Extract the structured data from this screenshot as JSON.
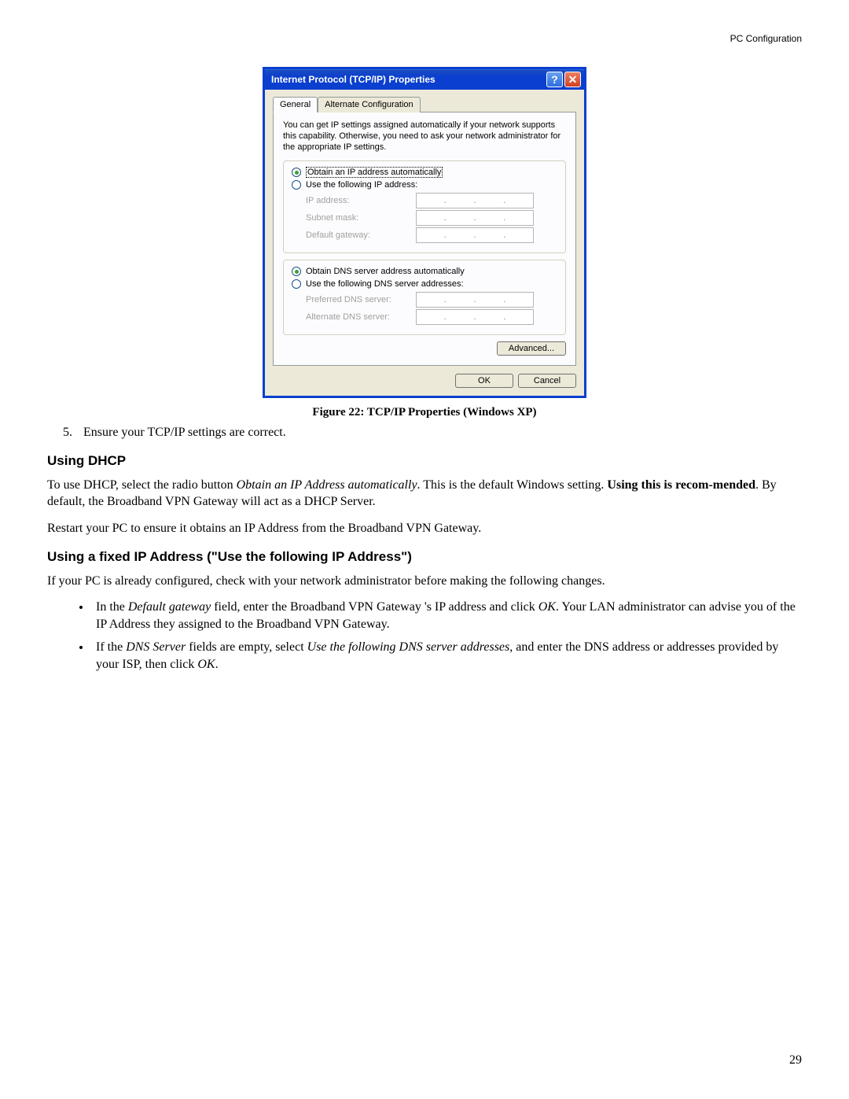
{
  "page": {
    "header": "PC Configuration",
    "number": "29"
  },
  "dialog": {
    "title": "Internet Protocol (TCP/IP) Properties",
    "helpGlyph": "?",
    "closeGlyph": "✕",
    "tabs": {
      "general": "General",
      "alt": "Alternate Configuration"
    },
    "description": "You can get IP settings assigned automatically if your network supports this capability. Otherwise, you need to ask your network administrator for the appropriate IP settings.",
    "ip": {
      "auto": "Obtain an IP address automatically",
      "manual": "Use the following IP address:",
      "fields": {
        "address": "IP address:",
        "subnet": "Subnet mask:",
        "gateway": "Default gateway:"
      }
    },
    "dns": {
      "auto": "Obtain DNS server address automatically",
      "manual": "Use the following DNS server addresses:",
      "fields": {
        "preferred": "Preferred DNS server:",
        "alternate": "Alternate DNS server:"
      }
    },
    "advanced": "Advanced...",
    "ok": "OK",
    "cancel": "Cancel"
  },
  "doc": {
    "caption": "Figure 22: TCP/IP Properties (Windows XP)",
    "step5_num": "5.",
    "step5_text": "Ensure your TCP/IP settings are correct.",
    "h_dhcp": "Using DHCP",
    "dhcp_p1_a": "To use DHCP, select the radio button ",
    "dhcp_p1_em": "Obtain an IP Address automatically",
    "dhcp_p1_b": ". This is the default Windows setting. ",
    "dhcp_p1_strong": "Using this is recom-mended",
    "dhcp_p1_c": ". By default, the Broadband VPN Gateway will act as a DHCP Server.",
    "dhcp_p2": "Restart your PC to ensure it obtains an IP Address from the Broadband VPN Gateway.",
    "h_fixed": "Using a fixed IP Address (\"Use the following IP Address\")",
    "fixed_p1": "If your PC is already configured, check with your network administrator before making the following changes.",
    "b1_a": "In the ",
    "b1_em1": "Default gateway",
    "b1_b": " field, enter the Broadband VPN Gateway 's IP address and click ",
    "b1_em2": "OK",
    "b1_c": ". Your LAN administrator can advise you of the IP Address they assigned to the Broadband VPN Gateway.",
    "b2_a": "If the ",
    "b2_em1": "DNS Server",
    "b2_b": " fields are empty, select ",
    "b2_em2": "Use the following DNS server addresses",
    "b2_c": ", and enter the DNS address or addresses provided by your ISP, then click ",
    "b2_em3": "OK",
    "b2_d": "."
  }
}
